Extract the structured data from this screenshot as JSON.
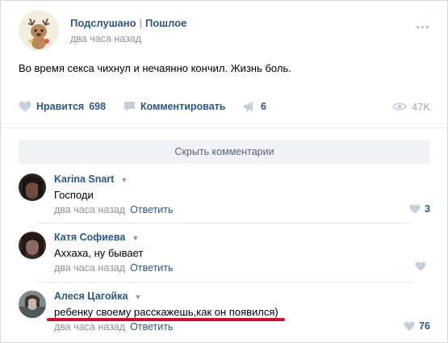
{
  "post": {
    "group_name": "Подслушано",
    "separator": "|",
    "group_sub": "Пошлое",
    "time": "два часа назад",
    "text": "Во время секса чихнул и нечаянно кончил. Жизнь боль.",
    "more_glyph": "•••"
  },
  "actions": {
    "like_label": "Нравится",
    "like_count": "698",
    "comment_label": "Комментировать",
    "share_count": "6",
    "views": "47K",
    "icons": [
      "heart-icon",
      "comment-icon",
      "megaphone-icon",
      "eye-icon"
    ]
  },
  "hide_comments_label": "Скрыть комментарии",
  "comments": [
    {
      "author": "Karina Snart",
      "text": "Господи",
      "time": "два часа назад",
      "reply": "Ответить",
      "likes": "3"
    },
    {
      "author": "Катя Софиева",
      "text": "Аххаха, ну бывает",
      "time": "два часа назад",
      "reply": "Ответить",
      "likes": ""
    },
    {
      "author": "Алеся Цагойка",
      "text": "ребенку своему расскажешь,как он появился)",
      "time": "два часа назад",
      "reply": "Ответить",
      "likes": "76"
    }
  ],
  "colors": {
    "link": "#2a5885",
    "muted": "#939393",
    "highlight_underline": "#c8102e",
    "like_icon": "#c5d0db"
  }
}
